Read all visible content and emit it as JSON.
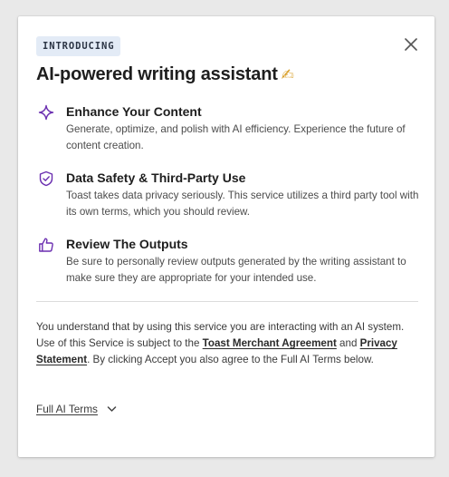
{
  "modal": {
    "badge": "INTRODUCING",
    "title": "AI-powered writing assistant",
    "title_emoji": "✍",
    "features": [
      {
        "icon": "sparkle-icon",
        "heading": "Enhance Your Content",
        "description": "Generate, optimize, and polish with AI efficiency. Experience the future of content creation."
      },
      {
        "icon": "shield-check-icon",
        "heading": "Data Safety & Third-Party Use",
        "description": "Toast takes data privacy seriously. This service utilizes a third party tool with its own terms, which you should review."
      },
      {
        "icon": "thumbs-up-icon",
        "heading": "Review The Outputs",
        "description": "Be sure to personally review outputs generated by the writing assistant to make sure they are appropriate for your intended use."
      }
    ],
    "disclaimer": {
      "part1": "You understand that by using this service you are interacting with an AI system. Use of this Service is subject to the ",
      "link1": "Toast Merchant Agreement",
      "part2": " and ",
      "link2": "Privacy Statement",
      "part3": ". By clicking Accept you also agree to the Full AI Terms below."
    },
    "terms_toggle": "Full AI Terms"
  },
  "colors": {
    "accent_purple": "#6b2fb0",
    "badge_bg": "#e3ebf6",
    "divider": "#dcdcdc"
  }
}
